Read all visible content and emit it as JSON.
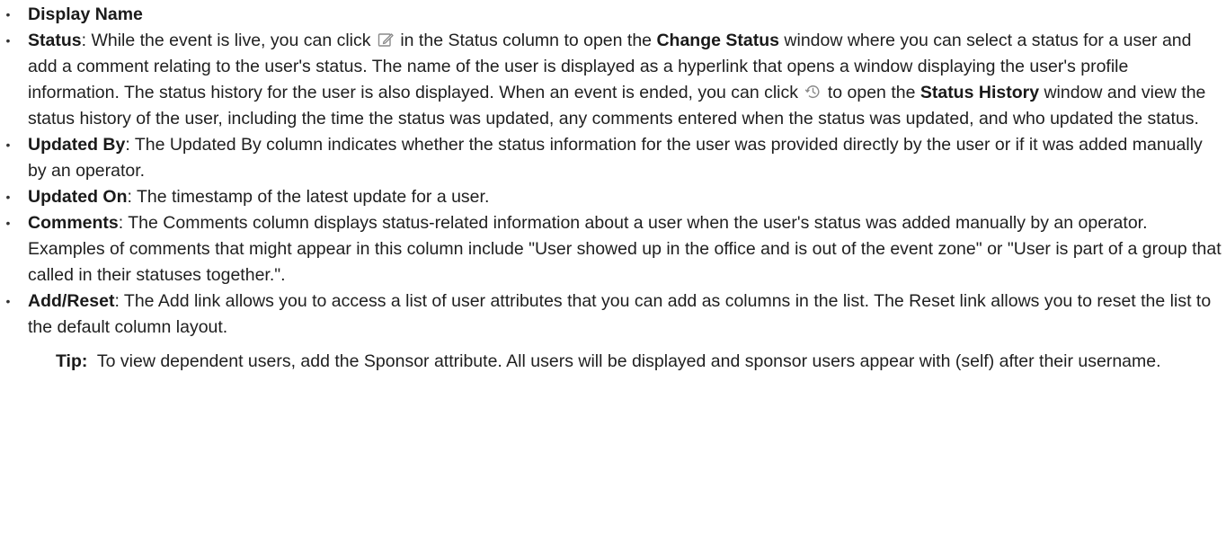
{
  "items": [
    {
      "term": "Display Name",
      "text": ""
    },
    {
      "term": "Status",
      "sep": ": ",
      "parts": {
        "p1": "While the event is live, you can click ",
        "icon1": "edit-icon",
        "p2": " in the Status column to open the ",
        "b1": "Change Status",
        "p3": " window where you can select a status for a user and add a comment relating to the user's status. The name of the user is displayed as a hyperlink that opens a window displaying the user's profile information. The status history for the user is also displayed. When an event is ended, you can click ",
        "icon2": "history-icon",
        "p4": " to open the ",
        "b2": "Status History",
        "p5": " window and view the status history of the user, including the time the status was updated, any comments entered when the status was updated, and who updated the status."
      }
    },
    {
      "term": "Updated By",
      "sep": ": ",
      "text": "The Updated By column indicates whether the status information for the user was provided directly by the user or if it was added manually by an operator."
    },
    {
      "term": "Updated On",
      "sep": ": ",
      "text": "The timestamp of the latest update for a user."
    },
    {
      "term": "Comments",
      "sep": ": ",
      "text": "The Comments column displays status-related information about a user when the user's status was added manually by an operator. Examples of comments that might appear in this column include \"User showed up in the office and is out of the event zone\" or \"User is part of a group that called in their statuses together.\"."
    },
    {
      "term": "Add/Reset",
      "sep": ": ",
      "text": "The Add link allows you to access a list of user attributes that you can add as columns in the list. The Reset link allows you to reset the list to the default column layout."
    }
  ],
  "bullet": "•",
  "tip": {
    "label": "Tip:",
    "text": "  To view dependent users, add the Sponsor attribute. All users will be displayed and sponsor users appear with (self) after their username."
  },
  "colors": {
    "text": "#1f1f1f",
    "icon": "#8a8a8a"
  }
}
